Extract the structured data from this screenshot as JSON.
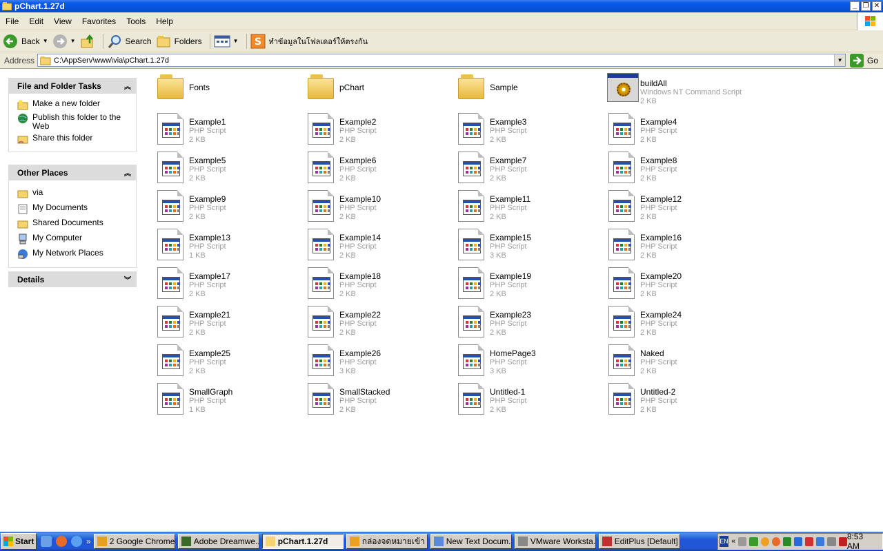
{
  "window": {
    "title": "pChart.1.27d"
  },
  "menu": [
    "File",
    "Edit",
    "View",
    "Favorites",
    "Tools",
    "Help"
  ],
  "toolbar": {
    "back": "Back",
    "search": "Search",
    "folders": "Folders",
    "thai_button": "ทำข้อมูลในโฟลเดอร์ให้ตรงกัน"
  },
  "address": {
    "label": "Address",
    "path": "C:\\AppServ\\www\\via\\pChart.1.27d",
    "go": "Go"
  },
  "left_pane": {
    "file_tasks": {
      "title": "File and Folder Tasks",
      "items": [
        "Make a new folder",
        "Publish this folder to the Web",
        "Share this folder"
      ]
    },
    "other_places": {
      "title": "Other Places",
      "items": [
        "via",
        "My Documents",
        "Shared Documents",
        "My Computer",
        "My Network Places"
      ]
    },
    "details": {
      "title": "Details"
    }
  },
  "files": [
    {
      "name": "Fonts",
      "kind": "folder"
    },
    {
      "name": "pChart",
      "kind": "folder"
    },
    {
      "name": "Sample",
      "kind": "folder"
    },
    {
      "name": "buildAll",
      "kind": "cmd",
      "type": "Windows NT Command Script",
      "size": "2 KB"
    },
    {
      "name": "Example1",
      "type": "PHP Script",
      "size": "2 KB"
    },
    {
      "name": "Example2",
      "type": "PHP Script",
      "size": "2 KB"
    },
    {
      "name": "Example3",
      "type": "PHP Script",
      "size": "2 KB"
    },
    {
      "name": "Example4",
      "type": "PHP Script",
      "size": "2 KB"
    },
    {
      "name": "Example5",
      "type": "PHP Script",
      "size": "2 KB"
    },
    {
      "name": "Example6",
      "type": "PHP Script",
      "size": "2 KB"
    },
    {
      "name": "Example7",
      "type": "PHP Script",
      "size": "2 KB"
    },
    {
      "name": "Example8",
      "type": "PHP Script",
      "size": "2 KB"
    },
    {
      "name": "Example9",
      "type": "PHP Script",
      "size": "2 KB"
    },
    {
      "name": "Example10",
      "type": "PHP Script",
      "size": "2 KB"
    },
    {
      "name": "Example11",
      "type": "PHP Script",
      "size": "2 KB"
    },
    {
      "name": "Example12",
      "type": "PHP Script",
      "size": "2 KB"
    },
    {
      "name": "Example13",
      "type": "PHP Script",
      "size": "1 KB"
    },
    {
      "name": "Example14",
      "type": "PHP Script",
      "size": "2 KB"
    },
    {
      "name": "Example15",
      "type": "PHP Script",
      "size": "3 KB"
    },
    {
      "name": "Example16",
      "type": "PHP Script",
      "size": "2 KB"
    },
    {
      "name": "Example17",
      "type": "PHP Script",
      "size": "2 KB"
    },
    {
      "name": "Example18",
      "type": "PHP Script",
      "size": "2 KB"
    },
    {
      "name": "Example19",
      "type": "PHP Script",
      "size": "2 KB"
    },
    {
      "name": "Example20",
      "type": "PHP Script",
      "size": "2 KB"
    },
    {
      "name": "Example21",
      "type": "PHP Script",
      "size": "2 KB"
    },
    {
      "name": "Example22",
      "type": "PHP Script",
      "size": "2 KB"
    },
    {
      "name": "Example23",
      "type": "PHP Script",
      "size": "2 KB"
    },
    {
      "name": "Example24",
      "type": "PHP Script",
      "size": "2 KB"
    },
    {
      "name": "Example25",
      "type": "PHP Script",
      "size": "2 KB"
    },
    {
      "name": "Example26",
      "type": "PHP Script",
      "size": "3 KB"
    },
    {
      "name": "HomePage3",
      "type": "PHP Script",
      "size": "3 KB"
    },
    {
      "name": "Naked",
      "type": "PHP Script",
      "size": "2 KB"
    },
    {
      "name": "SmallGraph",
      "type": "PHP Script",
      "size": "1 KB"
    },
    {
      "name": "SmallStacked",
      "type": "PHP Script",
      "size": "2 KB"
    },
    {
      "name": "Untitled-1",
      "type": "PHP Script",
      "size": "2 KB"
    },
    {
      "name": "Untitled-2",
      "type": "PHP Script",
      "size": "2 KB"
    }
  ],
  "taskbar": {
    "start": "Start",
    "buttons": [
      {
        "label": "2 Google Chrome",
        "icon": "chrome-icon",
        "active": false
      },
      {
        "label": "Adobe Dreamwe...",
        "icon": "dreamweaver-icon",
        "active": false
      },
      {
        "label": "pChart.1.27d",
        "icon": "folder-icon",
        "active": true
      },
      {
        "label": "กล่องจดหมายเข้า ...",
        "icon": "outlook-icon",
        "active": false
      },
      {
        "label": "New Text Docum...",
        "icon": "notepad-icon",
        "active": false
      },
      {
        "label": "VMware Worksta...",
        "icon": "vmware-icon",
        "active": false
      },
      {
        "label": "EditPlus [Default] ...",
        "icon": "editplus-icon",
        "active": false
      }
    ],
    "tray": {
      "lang": "EN",
      "clock": "8:53 AM"
    }
  },
  "colors": {
    "title_bar": "#0453e0",
    "taskbar": "#2157d7",
    "chrome": "#ece9d8",
    "panel_head": "#dcdcdc"
  }
}
